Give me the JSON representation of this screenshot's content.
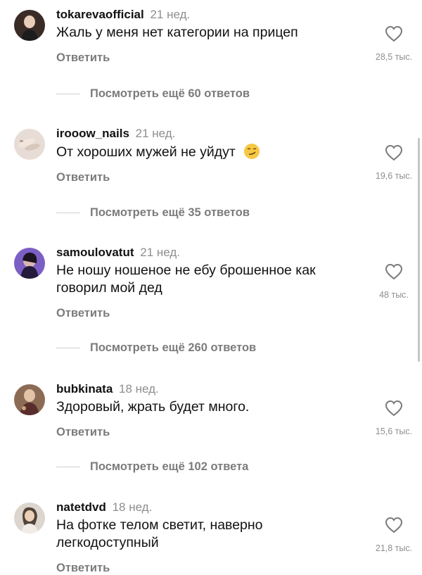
{
  "comments": [
    {
      "username": "tokarevaofficial",
      "time": "21 нед.",
      "text": "Жаль у меня нет категории на прицеп",
      "reply_label": "Ответить",
      "likes": "28,5 тыс.",
      "view_more": "Посмотреть ещё 60 ответов"
    },
    {
      "username": "iroоow_nails",
      "time": "21 нед.",
      "text": "От хороших мужей не уйдут",
      "reply_label": "Ответить",
      "likes": "19,6 тыс.",
      "view_more": "Посмотреть ещё 35 ответов",
      "emoji": "smirking-face-emoji"
    },
    {
      "username": "samoulovatut",
      "time": "21 нед.",
      "text_line1": "Не ношу ношеное не ебу брошенное как",
      "text_line2": "говорил мой дед",
      "reply_label": "Ответить",
      "likes": "48 тыс.",
      "view_more": "Посмотреть ещё 260 ответов"
    },
    {
      "username": "bubkinata",
      "time": "18 нед.",
      "text": "Здоровый, жрать будет много.",
      "reply_label": "Ответить",
      "likes": "15,6 тыс.",
      "view_more": "Посмотреть ещё 102 ответа"
    },
    {
      "username": "natetdvd",
      "time": "18 нед.",
      "text_line1": "На фотке телом светит, наверно",
      "text_line2": "легкодоступный",
      "reply_label": "Ответить",
      "likes": "21,8 тыс."
    }
  ],
  "icons": {
    "like": "heart-outline-icon"
  },
  "colors": {
    "muted": "#8e8e8e",
    "text": "#111111",
    "background": "#ffffff"
  }
}
